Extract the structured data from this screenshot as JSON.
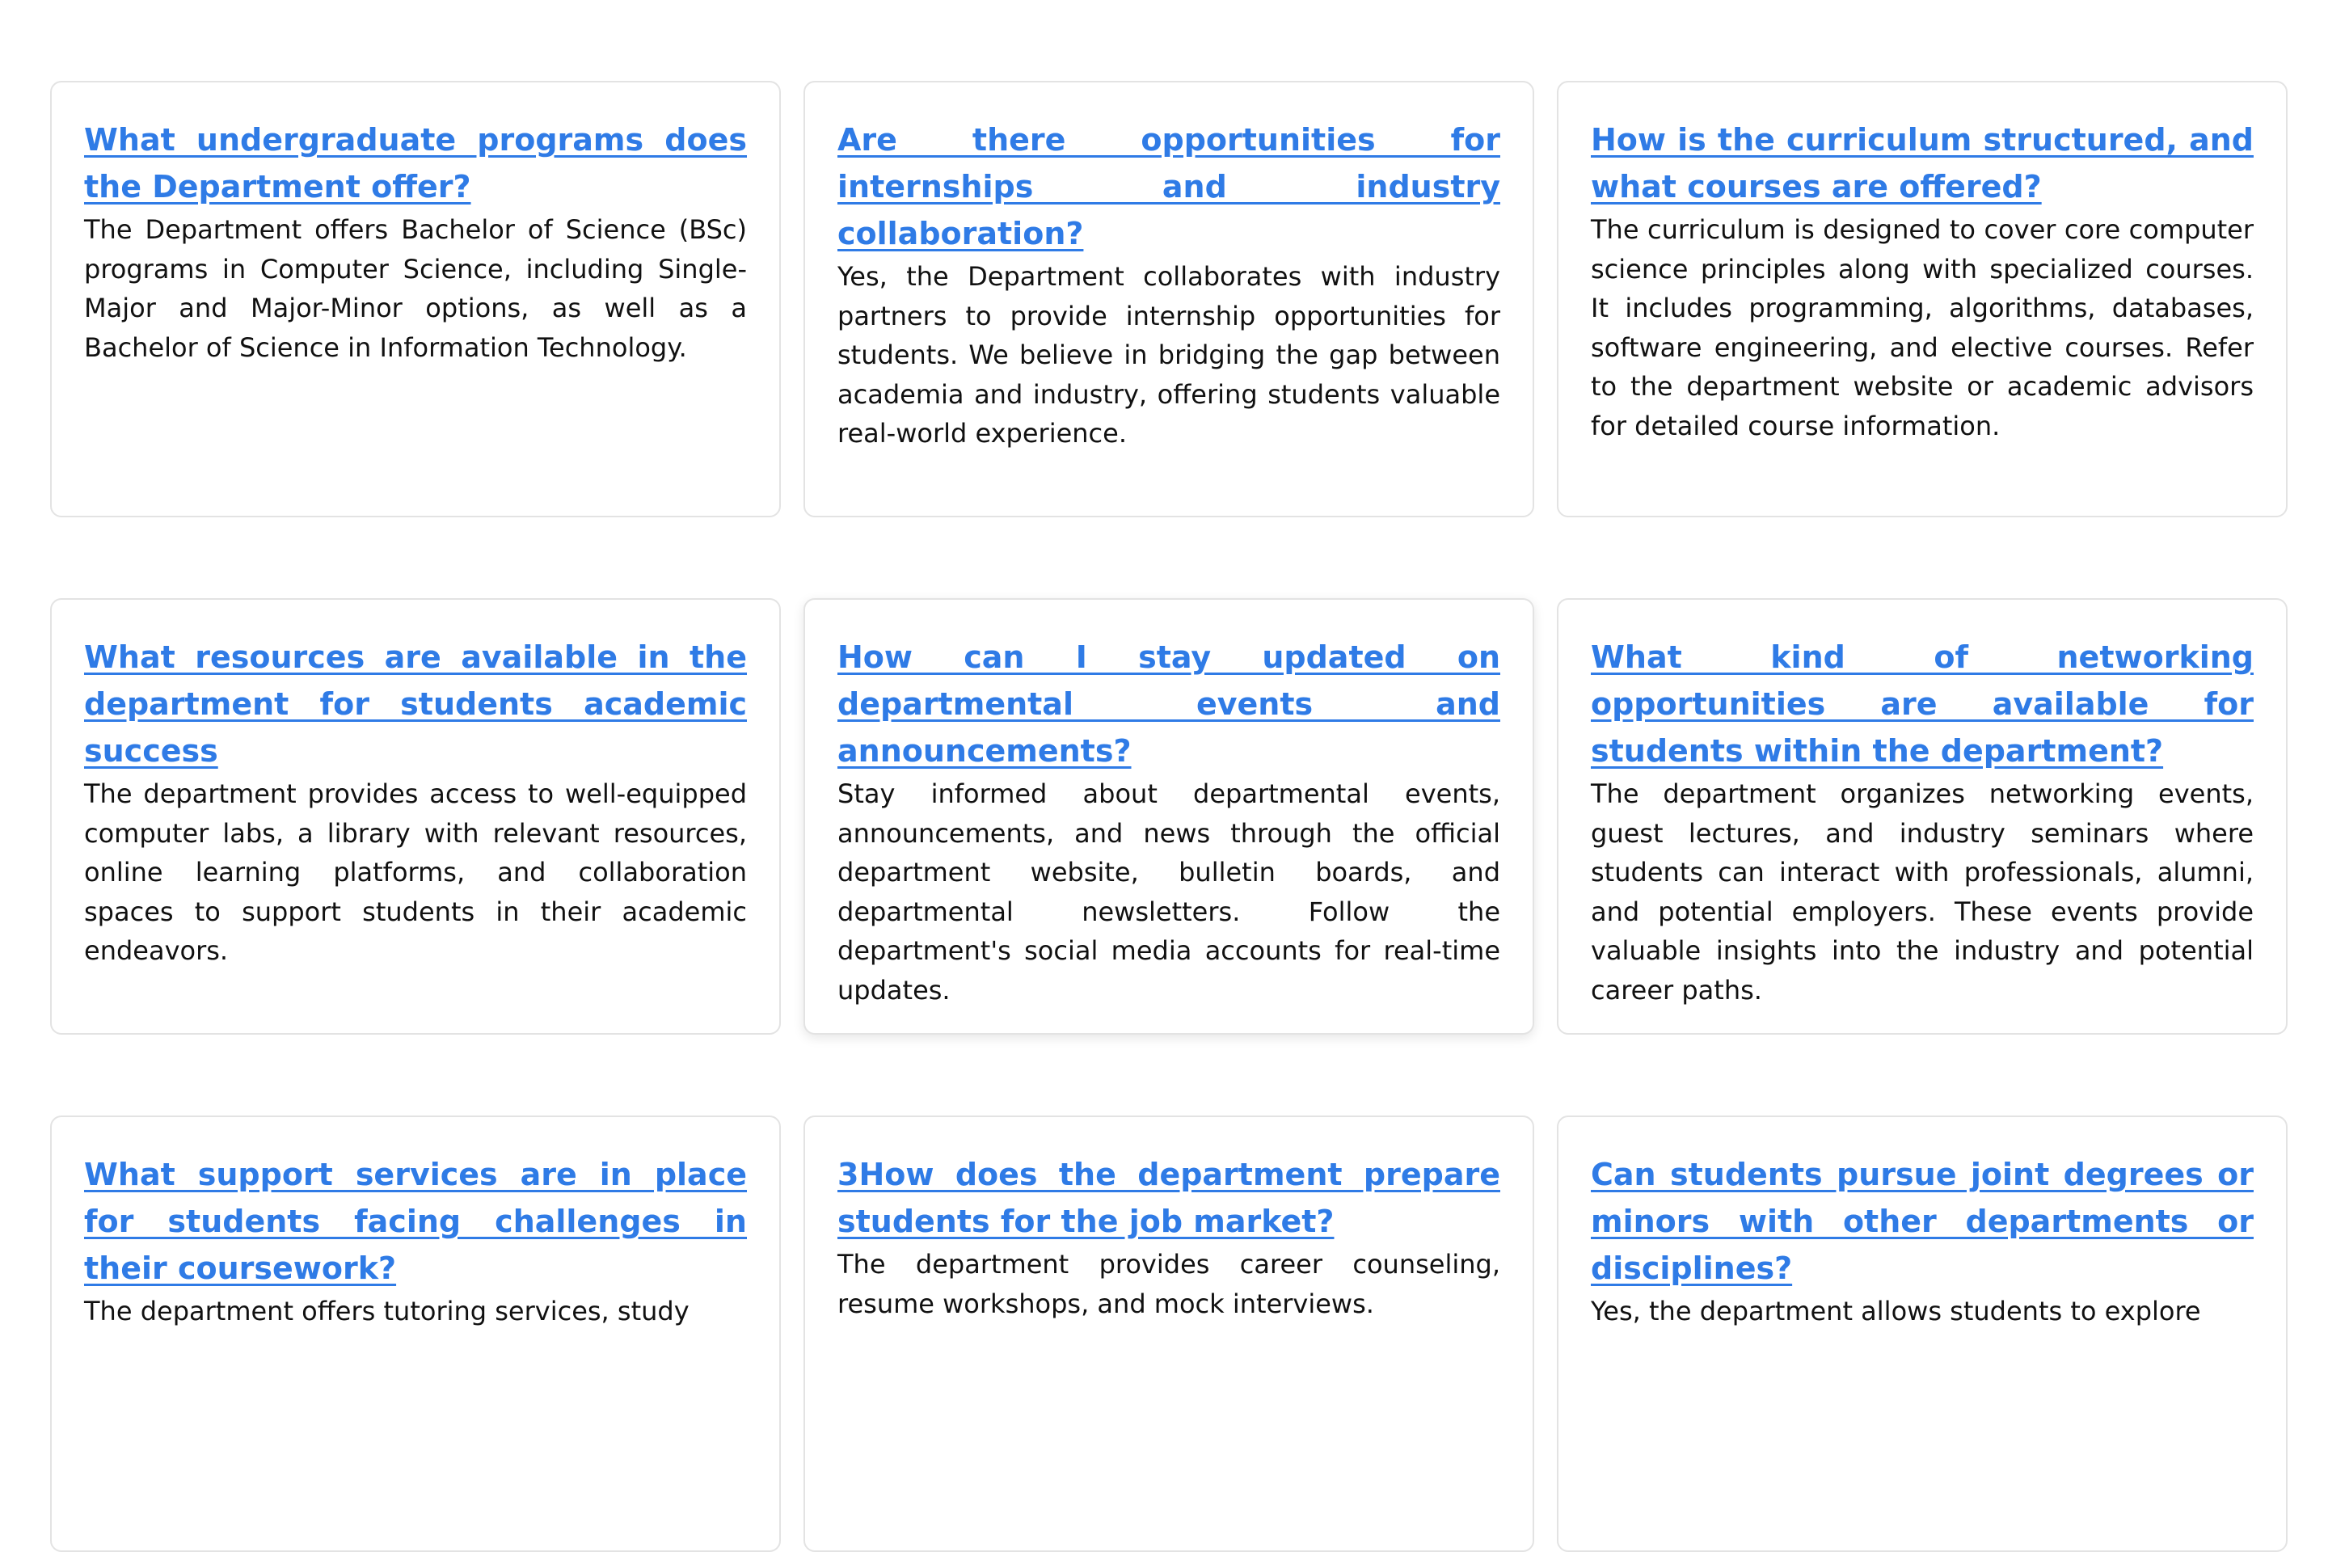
{
  "faq": {
    "items": [
      {
        "question": "What undergraduate programs does the Department offer?",
        "answer": "The Department offers Bachelor of Science (BSc) programs in Computer Science, including Single-Major and Major-Minor options, as well as a Bachelor of Science in Information Technology."
      },
      {
        "question": "Are there opportunities for internships and industry collaboration?",
        "answer": "Yes, the Department collaborates with industry partners to provide internship opportunities for students. We believe in bridging the gap between academia and industry, offering students valuable real-world experience."
      },
      {
        "question": "How is the curriculum structured, and what courses are offered?",
        "answer": "The curriculum is designed to cover core computer science principles along with specialized courses. It includes programming, algorithms, databases, software engineering, and elective courses. Refer to the department website or academic advisors for detailed course information."
      },
      {
        "question": "What resources are available in the department for students academic success",
        "answer": "The department provides access to well-equipped computer labs, a library with relevant resources, online learning platforms, and collaboration spaces to support students in their academic endeavors."
      },
      {
        "question": "How can I stay updated on departmental events and announcements?",
        "answer": "Stay informed about departmental events, announcements, and news through the official department website, bulletin boards, and departmental newsletters. Follow the department's social media accounts for real-time updates."
      },
      {
        "question": "What kind of networking opportunities are available for students within the department?",
        "answer": "The department organizes networking events, guest lectures, and industry seminars where students can interact with professionals, alumni, and potential employers. These events provide valuable insights into the industry and potential career paths."
      },
      {
        "question": "What support services are in place for students facing challenges in their coursework?",
        "answer": "The department offers tutoring services, study"
      },
      {
        "question": "3How does the department prepare students for the job market?",
        "answer": "The department provides career counseling, resume workshops, and mock interviews."
      },
      {
        "question": "Can students pursue joint degrees or minors with other departments or disciplines?",
        "answer": "Yes, the department allows students to explore"
      }
    ]
  },
  "colors": {
    "link": "#2f7be6",
    "text": "#111111",
    "border": "#e3e3e3"
  }
}
